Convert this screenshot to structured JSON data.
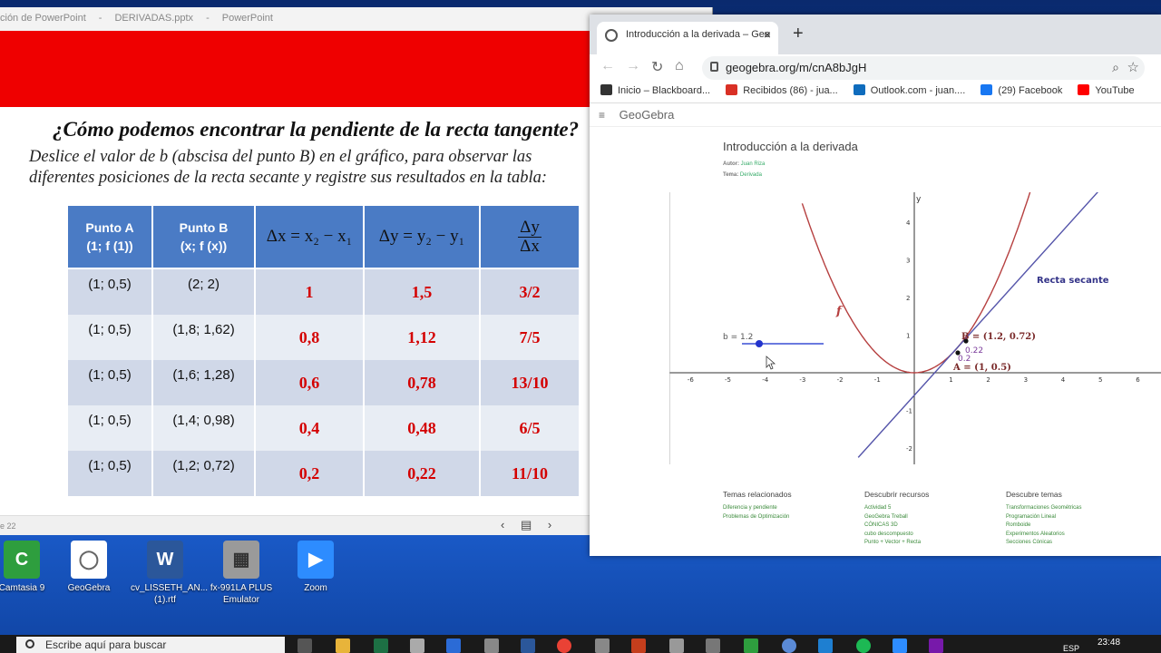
{
  "ppt": {
    "title_parts": [
      "ción de PowerPoint",
      "-",
      "DERIVADAS.pptx",
      "-",
      "PowerPoint"
    ],
    "slide_title": "¿Cómo podemos encontrar la pendiente de la recta tangente?",
    "slide_text": "Deslice el valor de b (abscisa del punto B) en el gráfico, para observar las diferentes posiciones de la recta secante y registre sus resultados en la tabla:",
    "table": {
      "headers": {
        "a_line1": "Punto A",
        "a_line2": "(1; f (1))",
        "b_line1": "Punto B",
        "b_line2": "(x; f (x))",
        "dx": "Δx = x₂ − x₁",
        "dy": "Δy = y₂ − y₁",
        "ratio_num": "Δy",
        "ratio_den": "Δx"
      },
      "rows": [
        {
          "a": "(1; 0,5)",
          "b": "(2; 2)",
          "dx": "1",
          "dy": "1,5",
          "ratio": "3/2"
        },
        {
          "a": "(1; 0,5)",
          "b": "(1,8; 1,62)",
          "dx": "0,8",
          "dy": "1,12",
          "ratio": "7/5"
        },
        {
          "a": "(1; 0,5)",
          "b": "(1,6; 1,28)",
          "dx": "0,6",
          "dy": "0,78",
          "ratio": "13/10"
        },
        {
          "a": "(1; 0,5)",
          "b": "(1,4; 0,98)",
          "dx": "0,4",
          "dy": "0,48",
          "ratio": "6/5"
        },
        {
          "a": "(1; 0,5)",
          "b": "(1,2; 0,72)",
          "dx": "0,2",
          "dy": "0,22",
          "ratio": "11/10"
        }
      ]
    },
    "status_left": "e 22",
    "nav_prev": "‹",
    "nav_slides": "▤",
    "nav_next": "›"
  },
  "chrome": {
    "tab_title": "Introducción a la derivada – Geo",
    "tab_close": "×",
    "new_tab": "+",
    "url": "geogebra.org/m/cnA8bJgH",
    "back": "←",
    "forward": "→",
    "reload": "↻",
    "home": "⌂",
    "zoom_icon": "⌕",
    "star_icon": "☆",
    "bookmarks": [
      {
        "label": "Inicio – Blackboard...",
        "color": "#333333"
      },
      {
        "label": "Recibidos (86) - jua...",
        "color": "#d93025"
      },
      {
        "label": "Outlook.com - juan....",
        "color": "#0f6cbd"
      },
      {
        "label": "(29) Facebook",
        "color": "#1877f2"
      },
      {
        "label": "YouTube",
        "color": "#ff0000"
      }
    ]
  },
  "geogebra": {
    "menu_icon": "≡",
    "brand": "GeoGebra",
    "title": "Introducción a la derivada",
    "author_label": "Autor:",
    "author": "Juan Riza",
    "topic_label": "Tema:",
    "topic": "Derivada",
    "graph": {
      "slider_label": "b = 1.2",
      "slider_value": 1.2,
      "f_label": "f",
      "secant_label": "Recta secante",
      "point_b": "B = (1.2, 0.72)",
      "point_a": "A = (1, 0.5)",
      "dy_label": "0.22",
      "dx_label": "0.2",
      "y_axis_label": "y",
      "x_ticks": [
        "-6",
        "-5",
        "-4",
        "-3",
        "-2",
        "-1",
        "0",
        "1",
        "2",
        "3",
        "4",
        "5",
        "6"
      ],
      "y_ticks": [
        "4",
        "3",
        "2",
        "1",
        "-1",
        "-2"
      ]
    },
    "footer": {
      "col1_head": "Temas relacionados",
      "col1_links": [
        "Diferencia y pendiente",
        "Problemas de Optimización"
      ],
      "col2_head": "Descubrir recursos",
      "col2_links": [
        "Actividad 5",
        "GeoGebra Treball",
        "CÓNICAS 3D",
        "cubo descompuesto",
        "Punto + Vector + Recta"
      ],
      "col3_head": "Descubre temas",
      "col3_links": [
        "Transformaciones Geométricas",
        "Programación Lineal",
        "Romboide",
        "Experimentos Aleatorios",
        "Secciones Cónicas"
      ]
    }
  },
  "desktop": {
    "icons": [
      {
        "label": "Camtasia 9",
        "color": "#2e9e3e",
        "glyph": "C"
      },
      {
        "label": "GeoGebra",
        "color": "#ffffff",
        "glyph": "◯"
      },
      {
        "label": "cv_LISSETH_AN...(1).rtf",
        "color": "#2b579a",
        "glyph": "W"
      },
      {
        "label": "fx-991LA PLUS Emulator",
        "color": "#9a9a9a",
        "glyph": "▦"
      },
      {
        "label": "Zoom",
        "color": "#2d8cff",
        "glyph": "▶"
      }
    ]
  },
  "taskbar": {
    "search_placeholder": "Escribe aquí para buscar",
    "lang": "ESP",
    "time": "23:48"
  }
}
